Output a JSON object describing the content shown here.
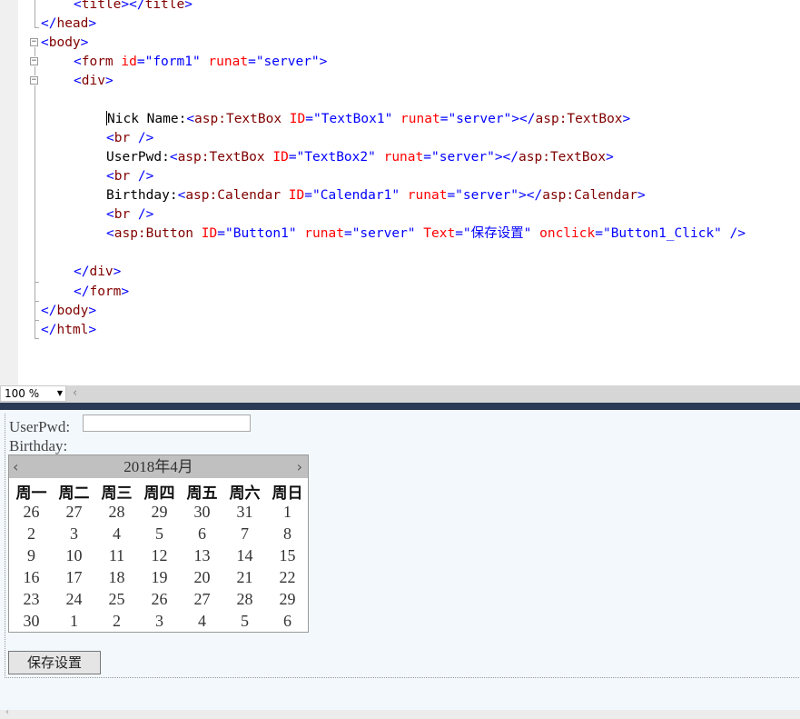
{
  "editor": {
    "lines": {
      "l0": {
        "open": "<",
        "tag": "title",
        "mid": "></",
        "tag2": "title",
        "close": ">"
      },
      "l1": {
        "open": "</",
        "tag": "head",
        "close": ">"
      },
      "l2": {
        "open": "<",
        "tag": "body",
        "close": ">"
      },
      "l3": {
        "open": "<",
        "tag": "form",
        "a1": " id",
        "eq1": "=",
        "v1": "\"form1\"",
        "a2": " runat",
        "eq2": "=",
        "v2": "\"server\"",
        "close": ">"
      },
      "l4": {
        "open": "<",
        "tag": "div",
        "close": ">"
      },
      "l6": {
        "text": "Nick Name:",
        "open": "<",
        "tag": "asp:TextBox",
        "a1": " ID",
        "eq1": "=",
        "v1": "\"TextBox1\"",
        "a2": " runat",
        "eq2": "=",
        "v2": "\"server\"",
        "mid": "></",
        "tag2": "asp:TextBox",
        "close": ">"
      },
      "l7": {
        "open": "<",
        "tag": "br",
        "close": " />"
      },
      "l8": {
        "text": "UserPwd:",
        "open": "<",
        "tag": "asp:TextBox",
        "a1": " ID",
        "eq1": "=",
        "v1": "\"TextBox2\"",
        "a2": " runat",
        "eq2": "=",
        "v2": "\"server\"",
        "mid": "></",
        "tag2": "asp:TextBox",
        "close": ">"
      },
      "l9": {
        "open": "<",
        "tag": "br",
        "close": " />"
      },
      "l10": {
        "text": "Birthday:",
        "open": "<",
        "tag": "asp:Calendar",
        "a1": " ID",
        "eq1": "=",
        "v1": "\"Calendar1\"",
        "a2": " runat",
        "eq2": "=",
        "v2": "\"server\"",
        "mid": "></",
        "tag2": "asp:Calendar",
        "close": ">"
      },
      "l11": {
        "open": "<",
        "tag": "br",
        "close": " />"
      },
      "l12": {
        "open": "<",
        "tag": "asp:Button",
        "a1": " ID",
        "eq1": "=",
        "v1": "\"Button1\"",
        "a2": " runat",
        "eq2": "=",
        "v2": "\"server\"",
        "a3": " Text",
        "eq3": "=",
        "v3": "\"保存设置\"",
        "a4": " onclick",
        "eq4": "=",
        "v4": "\"Button1_Click\"",
        "close": " />"
      },
      "l14": {
        "open": "</",
        "tag": "div",
        "close": ">"
      },
      "l15": {
        "open": "</",
        "tag": "form",
        "close": ">"
      },
      "l16": {
        "open": "</",
        "tag": "body",
        "close": ">"
      },
      "l17": {
        "open": "</",
        "tag": "html",
        "close": ">"
      }
    }
  },
  "statusbar": {
    "zoom": "100 %",
    "zoom_arrow": "▼",
    "scroll_left": "‹"
  },
  "design": {
    "userpwd_label": "UserPwd:",
    "birthday_label": "Birthday:",
    "calendar": {
      "title": "2018年4月",
      "prev": "‹",
      "next": "›",
      "weekdays": [
        "周一",
        "周二",
        "周三",
        "周四",
        "周五",
        "周六",
        "周日"
      ],
      "weeks": [
        [
          "26",
          "27",
          "28",
          "29",
          "30",
          "31",
          "1"
        ],
        [
          "2",
          "3",
          "4",
          "5",
          "6",
          "7",
          "8"
        ],
        [
          "9",
          "10",
          "11",
          "12",
          "13",
          "14",
          "15"
        ],
        [
          "16",
          "17",
          "18",
          "19",
          "20",
          "21",
          "22"
        ],
        [
          "23",
          "24",
          "25",
          "26",
          "27",
          "28",
          "29"
        ],
        [
          "30",
          "1",
          "2",
          "3",
          "4",
          "5",
          "6"
        ]
      ]
    },
    "save_button": "保存设置"
  },
  "bottombar": {
    "scroll_left": "‹"
  }
}
